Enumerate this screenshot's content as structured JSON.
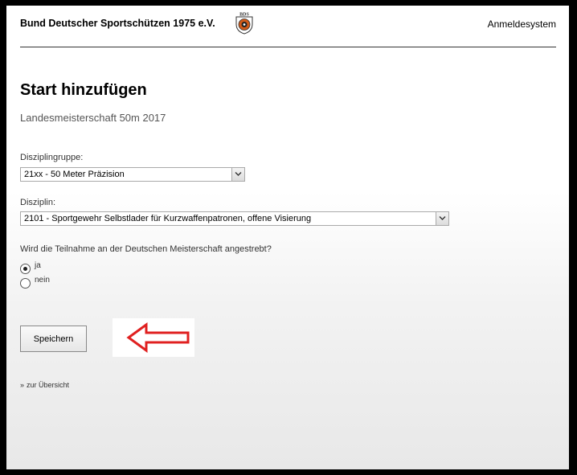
{
  "header": {
    "org_name": "Bund Deutscher Sportschützen 1975 e.V.",
    "logo_text": "BDS",
    "system_name": "Anmeldesystem"
  },
  "page": {
    "title": "Start hinzufügen",
    "event": "Landesmeisterschaft 50m 2017"
  },
  "form": {
    "group_label": "Disziplingruppe:",
    "group_value": "21xx - 50 Meter Präzision",
    "discipline_label": "Disziplin:",
    "discipline_value": "2101 - Sportgewehr Selbstlader für Kurzwaffenpatronen, offene Visierung",
    "question": "Wird die Teilnahme an der Deutschen Meisterschaft angestrebt?",
    "options": [
      {
        "label": "ja",
        "selected": true
      },
      {
        "label": "nein",
        "selected": false
      }
    ],
    "save_label": "Speichern"
  },
  "footer": {
    "back_link": "zur Übersicht"
  },
  "annotation": {
    "arrow_color": "#e02020",
    "direction": "left"
  }
}
